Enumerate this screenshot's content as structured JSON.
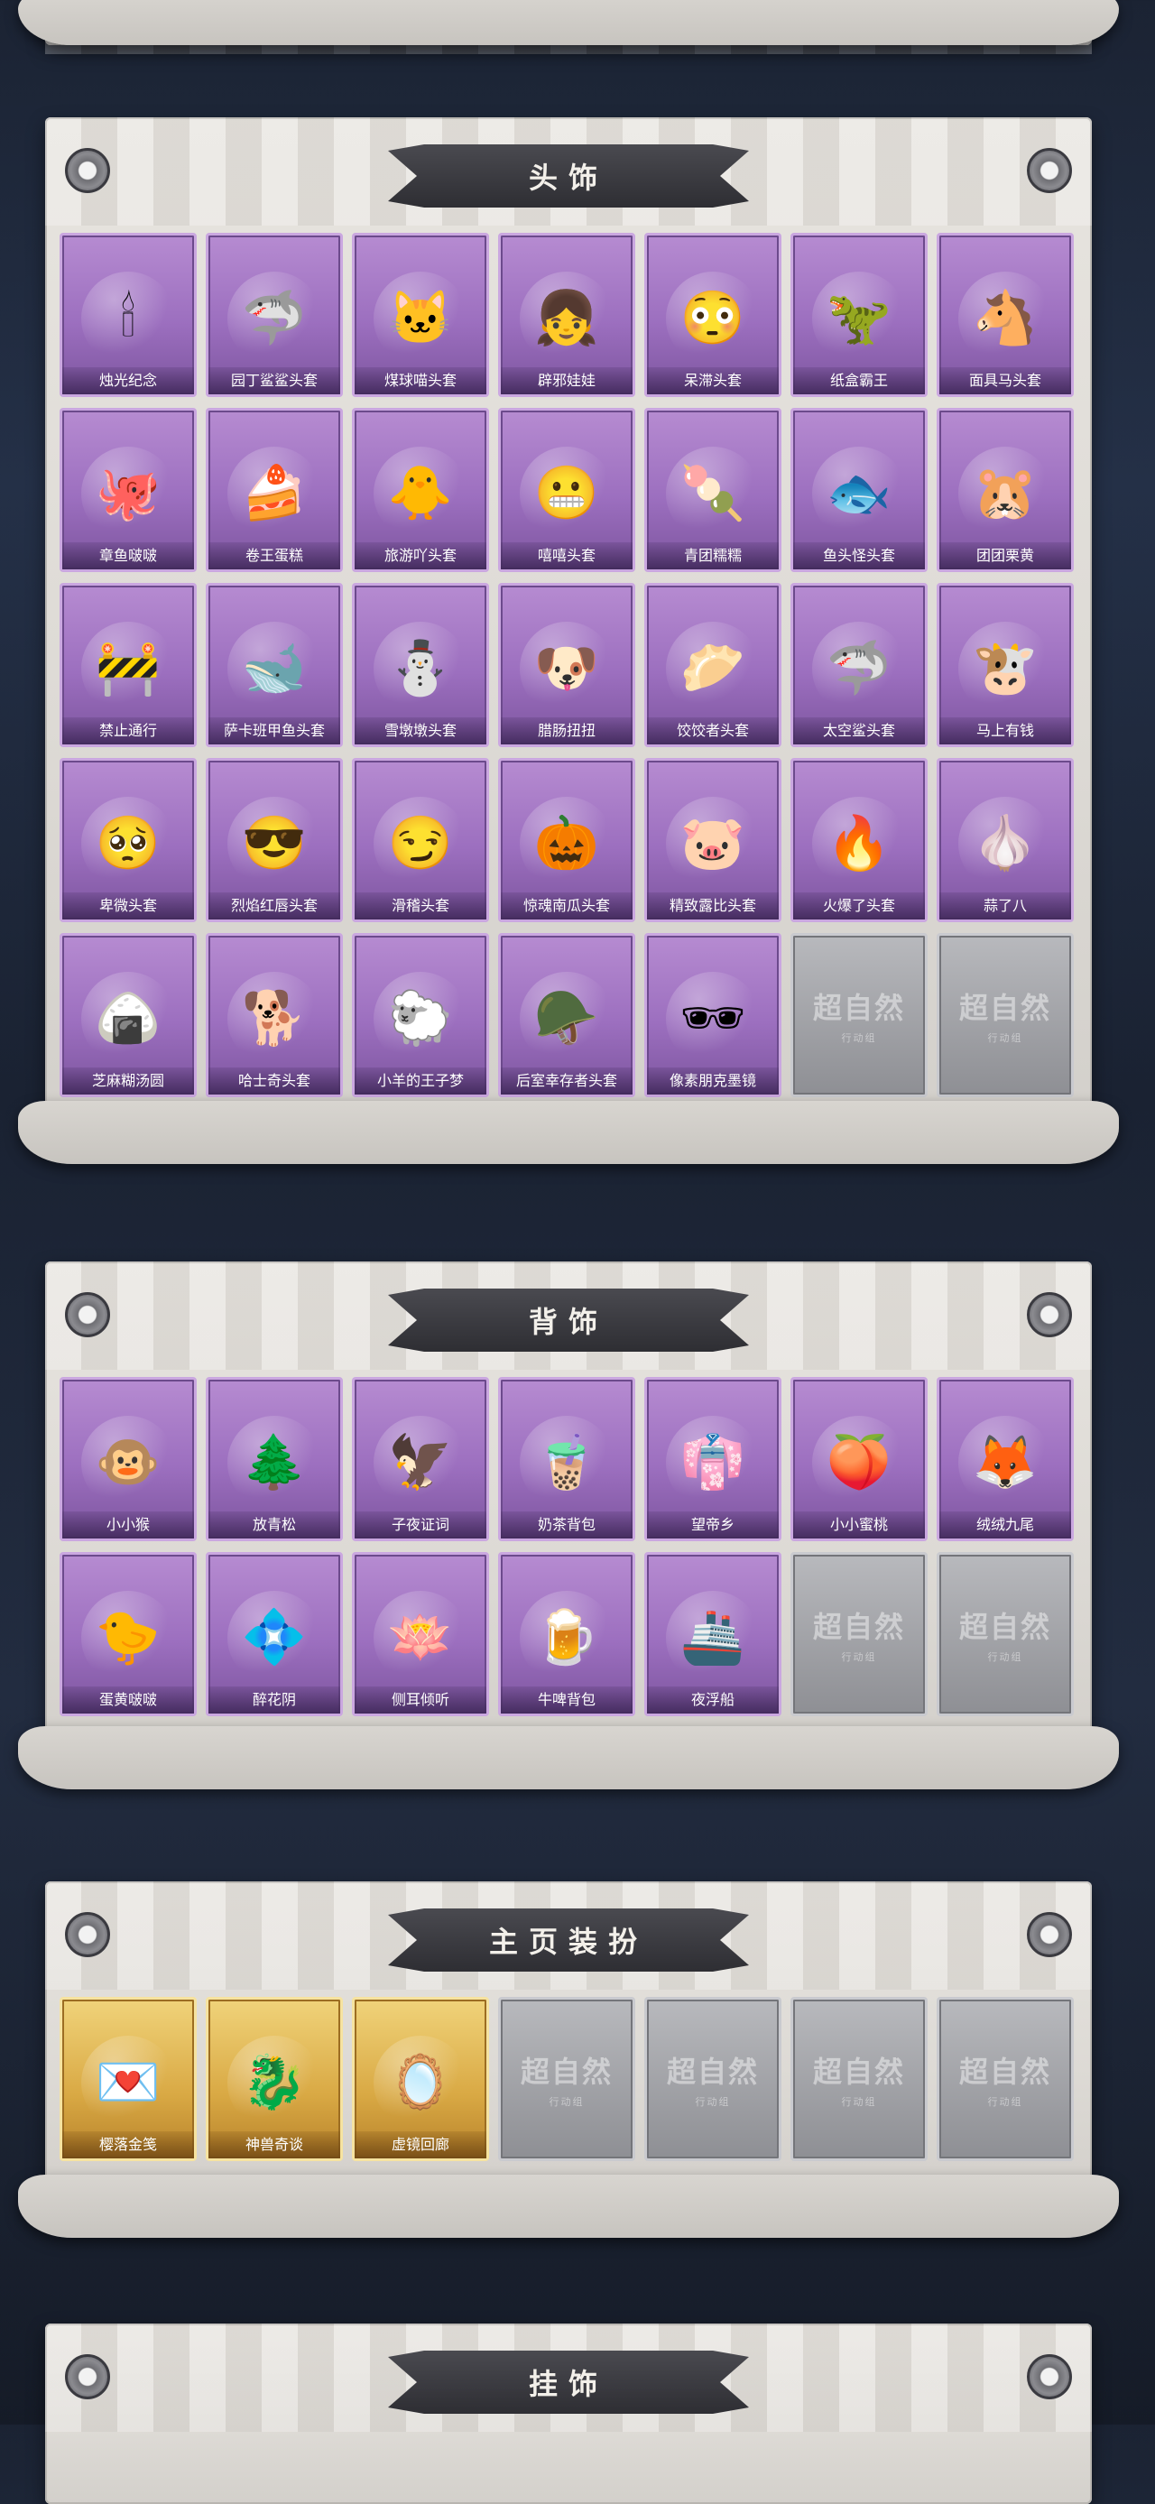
{
  "sections": {
    "head": {
      "title": "头饰",
      "items": [
        {
          "label": "烛光纪念",
          "icon": "🕯"
        },
        {
          "label": "园丁鲨鲨头套",
          "icon": "🦈"
        },
        {
          "label": "煤球喵头套",
          "icon": "🐱"
        },
        {
          "label": "辟邪娃娃",
          "icon": "👧"
        },
        {
          "label": "呆滞头套",
          "icon": "😳"
        },
        {
          "label": "纸盒霸王",
          "icon": "🦖"
        },
        {
          "label": "面具马头套",
          "icon": "🐴"
        },
        {
          "label": "章鱼啵啵",
          "icon": "🐙"
        },
        {
          "label": "卷王蛋糕",
          "icon": "🍰"
        },
        {
          "label": "旅游吖头套",
          "icon": "🐥"
        },
        {
          "label": "嘻嘻头套",
          "icon": "😬"
        },
        {
          "label": "青团糯糯",
          "icon": "🍡"
        },
        {
          "label": "鱼头怪头套",
          "icon": "🐟"
        },
        {
          "label": "团团栗黄",
          "icon": "🐹"
        },
        {
          "label": "禁止通行",
          "icon": "🚧"
        },
        {
          "label": "萨卡班甲鱼头套",
          "icon": "🐋"
        },
        {
          "label": "雪墩墩头套",
          "icon": "⛄"
        },
        {
          "label": "腊肠扭扭",
          "icon": "🐶"
        },
        {
          "label": "饺饺者头套",
          "icon": "🥟"
        },
        {
          "label": "太空鲨头套",
          "icon": "🦈"
        },
        {
          "label": "马上有钱",
          "icon": "🐮"
        },
        {
          "label": "卑微头套",
          "icon": "🥺"
        },
        {
          "label": "烈焰红唇头套",
          "icon": "😎"
        },
        {
          "label": "滑稽头套",
          "icon": "😏"
        },
        {
          "label": "惊魂南瓜头套",
          "icon": "🎃"
        },
        {
          "label": "精致露比头套",
          "icon": "🐷"
        },
        {
          "label": "火爆了头套",
          "icon": "🔥"
        },
        {
          "label": "蒜了八",
          "icon": "🧄"
        },
        {
          "label": "芝麻糊汤圆",
          "icon": "🍙"
        },
        {
          "label": "哈士奇头套",
          "icon": "🐕"
        },
        {
          "label": "小羊的王子梦",
          "icon": "🐑"
        },
        {
          "label": "后室幸存者头套",
          "icon": "🪖"
        },
        {
          "label": "像素朋克墨镜",
          "icon": "🕶"
        }
      ],
      "locked_count": 2
    },
    "back": {
      "title": "背饰",
      "items": [
        {
          "label": "小小猴",
          "icon": "🐵"
        },
        {
          "label": "放青松",
          "icon": "🌲"
        },
        {
          "label": "子夜证词",
          "icon": "🦅"
        },
        {
          "label": "奶茶背包",
          "icon": "🧋"
        },
        {
          "label": "望帝乡",
          "icon": "👘"
        },
        {
          "label": "小小蜜桃",
          "icon": "🍑"
        },
        {
          "label": "绒绒九尾",
          "icon": "🦊"
        },
        {
          "label": "蛋黄啵啵",
          "icon": "🐤"
        },
        {
          "label": "醉花阴",
          "icon": "💠"
        },
        {
          "label": "侧耳倾听",
          "icon": "🪷"
        },
        {
          "label": "牛啤背包",
          "icon": "🍺"
        },
        {
          "label": "夜浮船",
          "icon": "🚢"
        }
      ],
      "locked_count": 2
    },
    "home": {
      "title": "主页装扮",
      "items": [
        {
          "label": "樱落金笺",
          "icon": "💌"
        },
        {
          "label": "神兽奇谈",
          "icon": "🐉"
        },
        {
          "label": "虚镜回廊",
          "icon": "🪞"
        }
      ],
      "locked_count": 4
    },
    "hang": {
      "title": "挂饰"
    }
  },
  "locked_card": {
    "watermark": "超自然",
    "sub": "行动组"
  },
  "colors": {
    "purple_card": "#9c6fbf",
    "gold_card": "#d9a944",
    "gray_card": "#8e8f94",
    "banner": "#2e2e33"
  }
}
